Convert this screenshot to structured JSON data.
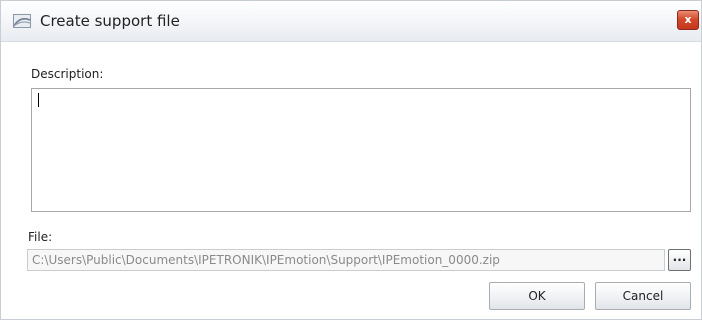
{
  "window": {
    "title": "Create support file",
    "icon": "app-logo-icon",
    "close_label": "x"
  },
  "description": {
    "label": "Description:",
    "value": ""
  },
  "file": {
    "label": "File:",
    "value": "C:\\Users\\Public\\Documents\\IPETRONIK\\IPEmotion\\Support\\IPEmotion_0000.zip",
    "browse_label": "..."
  },
  "buttons": {
    "ok_label": "OK",
    "cancel_label": "Cancel"
  },
  "colors": {
    "close_button": "#d54a2c",
    "titlebar": "#eef1f5"
  }
}
